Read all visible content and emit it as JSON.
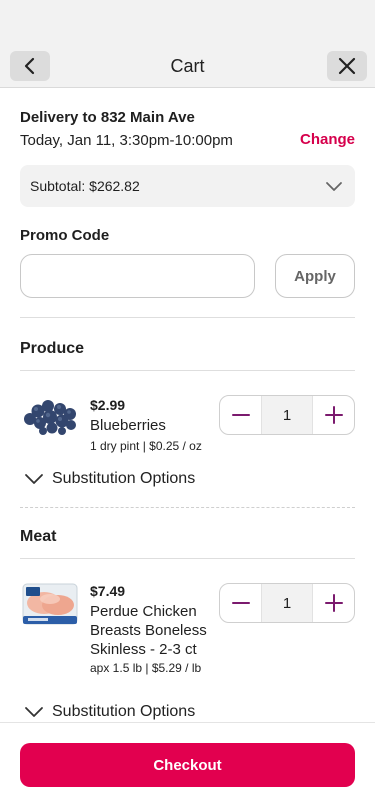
{
  "header": {
    "title": "Cart"
  },
  "delivery": {
    "title": "Delivery to 832 Main Ave",
    "time": "Today, Jan 11, 3:30pm-10:00pm",
    "change_label": "Change"
  },
  "subtotal": {
    "label": "Subtotal: $262.82"
  },
  "promo": {
    "label": "Promo Code",
    "value": "",
    "placeholder": "",
    "apply_label": "Apply"
  },
  "sections": [
    {
      "title": "Produce",
      "item": {
        "price": "$2.99",
        "name": "Blueberries",
        "detail": "1 dry pint | $0.25 / oz",
        "quantity": "1",
        "substitution_label": "Substitution Options"
      }
    },
    {
      "title": "Meat",
      "item": {
        "price": "$7.49",
        "name": "Perdue Chicken Breasts Boneless Skinless - 2-3 ct",
        "detail": "apx 1.5 lb | $5.29 / lb",
        "quantity": "1",
        "substitution_label": "Substitution Options"
      }
    }
  ],
  "checkout": {
    "label": "Checkout"
  },
  "colors": {
    "accent": "#e2004f",
    "link": "#d6004c",
    "stepper_icon": "#7b1a6e"
  },
  "icons": [
    "chevron-left-icon",
    "close-icon",
    "chevron-down-icon",
    "minus-icon",
    "plus-icon",
    "blueberries-image",
    "chicken-package-image"
  ]
}
